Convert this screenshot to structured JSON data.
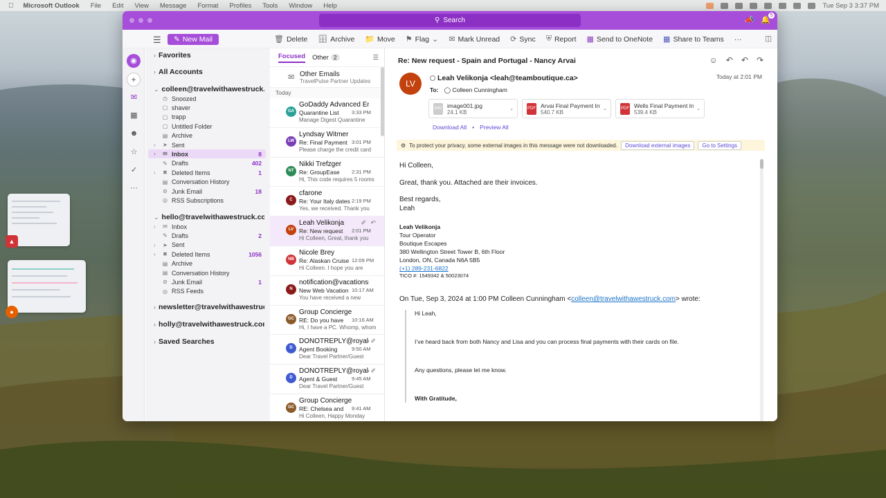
{
  "menubar": {
    "app": "Microsoft Outlook",
    "items": [
      "File",
      "Edit",
      "View",
      "Message",
      "Format",
      "Profiles",
      "Tools",
      "Window",
      "Help"
    ],
    "clock": "Tue Sep 3  3:37 PM"
  },
  "titlebar": {
    "search": "Search",
    "notif_count": "5"
  },
  "toolbar": {
    "new_mail": "New Mail",
    "delete": "Delete",
    "archive": "Archive",
    "move": "Move",
    "flag": "Flag",
    "mark_unread": "Mark Unread",
    "sync": "Sync",
    "report": "Report",
    "onenote": "Send to OneNote",
    "teams": "Share to Teams",
    "more": "···"
  },
  "folders": {
    "favorites": "Favorites",
    "all_accounts": "All Accounts",
    "acct1": "colleen@travelwithawestruck.com",
    "acct1_items": [
      {
        "label": "Snoozed",
        "count": ""
      },
      {
        "label": "shaver",
        "count": ""
      },
      {
        "label": "trapp",
        "count": ""
      },
      {
        "label": "Untitled Folder",
        "count": ""
      },
      {
        "label": "Archive",
        "count": ""
      },
      {
        "label": "Sent",
        "count": ""
      },
      {
        "label": "Inbox",
        "count": "8"
      },
      {
        "label": "Drafts",
        "count": "402"
      },
      {
        "label": "Deleted Items",
        "count": "1"
      },
      {
        "label": "Conversation History",
        "count": ""
      },
      {
        "label": "Junk Email",
        "count": "18"
      },
      {
        "label": "RSS Subscriptions",
        "count": ""
      }
    ],
    "acct2": "hello@travelwithawestruck.com",
    "acct2_items": [
      {
        "label": "Inbox",
        "count": ""
      },
      {
        "label": "Drafts",
        "count": "2"
      },
      {
        "label": "Sent",
        "count": ""
      },
      {
        "label": "Deleted Items",
        "count": "1056"
      },
      {
        "label": "Archive",
        "count": ""
      },
      {
        "label": "Conversation History",
        "count": ""
      },
      {
        "label": "Junk Email",
        "count": "1"
      },
      {
        "label": "RSS Feeds",
        "count": ""
      }
    ],
    "acct3": "newsletter@travelwithawestruck.com",
    "acct4": "holly@travelwithawestruck.com",
    "saved": "Saved Searches"
  },
  "messagelist": {
    "tab_focused": "Focused",
    "tab_other": "Other",
    "other_count": "2",
    "other_title": "Other Emails",
    "other_sub": "TravelPulse Partner Updates",
    "today": "Today",
    "messages": [
      {
        "init": "GA",
        "color": "#2aa198",
        "sender": "GoDaddy Advanced Email Security",
        "subject": "Quarantine List",
        "time": "3:33 PM",
        "preview": "Manage Digest Quarantine"
      },
      {
        "init": "LW",
        "color": "#7a3fb5",
        "sender": "Lyndsay Witmer",
        "subject": "Re: Final Payment",
        "time": "3:01 PM",
        "preview": "Please charge the credit card"
      },
      {
        "init": "NT",
        "color": "#2e8b57",
        "sender": "Nikki Trefzger",
        "subject": "Re: GroupEase",
        "time": "2:31 PM",
        "preview": "Hi, This code requires 5 rooms"
      },
      {
        "init": "C",
        "color": "#8b1a1a",
        "sender": "cfarone",
        "subject": "Re: Your Italy dates",
        "time": "2:19 PM",
        "preview": "Yes, we received. Thank you"
      },
      {
        "init": "LV",
        "color": "#c2410c",
        "sender": "Leah Velikonja",
        "subject": "Re: New request",
        "time": "2:01 PM",
        "preview": "Hi Colleen, Great, thank you"
      },
      {
        "init": "NB",
        "color": "#d13438",
        "sender": "Nicole Brey",
        "subject": "Re: Alaskan Cruise",
        "time": "12:09 PM",
        "preview": "Hi Colleen. I hope you are"
      },
      {
        "init": "N",
        "color": "#8b1a1a",
        "sender": "notification@vacationsbyrail.com",
        "subject": "New Web Vacation",
        "time": "10:17 AM",
        "preview": "You have received a new"
      },
      {
        "init": "GC",
        "color": "#8b5a2b",
        "sender": "Group Concierge",
        "subject": "RE: Do you have",
        "time": "10:16 AM",
        "preview": "Hi, I have a PC. Whomp, whomp"
      },
      {
        "init": "D",
        "color": "#3f5bd1",
        "sender": "DONOTREPLY@royalcaribbean.com",
        "subject": "Agent Booking",
        "time": "9:50 AM",
        "preview": "Dear Travel Partner/Guest"
      },
      {
        "init": "D",
        "color": "#3f5bd1",
        "sender": "DONOTREPLY@royalcaribbean.com",
        "subject": "Agent & Guest",
        "time": "9:45 AM",
        "preview": "Dear Travel Partner/Guest"
      },
      {
        "init": "GC",
        "color": "#8b5a2b",
        "sender": "Group Concierge",
        "subject": "RE: Chelsea and",
        "time": "9:41 AM",
        "preview": "Hi Colleen, Happy Monday"
      }
    ]
  },
  "reading": {
    "subject": "Re: New request - Spain and Portugal - Nancy Arvai",
    "avatar": "LV",
    "from": "Leah Velikonja <leah@teamboutique.ca>",
    "date": "Today at 2:01 PM",
    "to_label": "To:",
    "to": "Colleen Cunningham",
    "attachments": [
      {
        "name": "image001.jpg",
        "size": "24.1 KB",
        "type": "img"
      },
      {
        "name": "Arvai Final Payment Invoice.pdf",
        "size": "540.7 KB",
        "type": "pdf"
      },
      {
        "name": "Wells Final Payment Invoice.pdf",
        "size": "539.4 KB",
        "type": "pdf"
      }
    ],
    "download_all": "Download All",
    "dot": "•",
    "preview_all": "Preview All",
    "privacy": "To protect your privacy, some external images in this message were not downloaded.",
    "download_images": "Download external images",
    "go_settings": "Go to Settings",
    "greeting": "Hi Colleen,",
    "line1": "Great, thank you. Attached are their invoices.",
    "regards": "Best regards,",
    "regards_name": "Leah",
    "sig_name": "Leah Velikonja",
    "sig_title": "Tour Operator",
    "sig_company": "Boutique Escapes",
    "sig_addr1": "380 Wellington Street Tower B, 6th Floor",
    "sig_addr2": "London, ON, Canada N6A 5B5",
    "sig_phone": "(+1) 289-231-6822",
    "sig_tico": "TICO #: 1549342 & 50023074",
    "quote_pre": "On Tue, Sep 3, 2024 at 1:00 PM Colleen Cunningham <",
    "quote_email": "colleen@travelwithawestruck.com",
    "quote_post": "> wrote:",
    "q1": "Hi Leah,",
    "q2": "I’ve heard back from both Nancy and Lisa and you can process final payments with their cards on file.",
    "q3": "Any questions, please let me know.",
    "q4": "With Gratitude,"
  }
}
